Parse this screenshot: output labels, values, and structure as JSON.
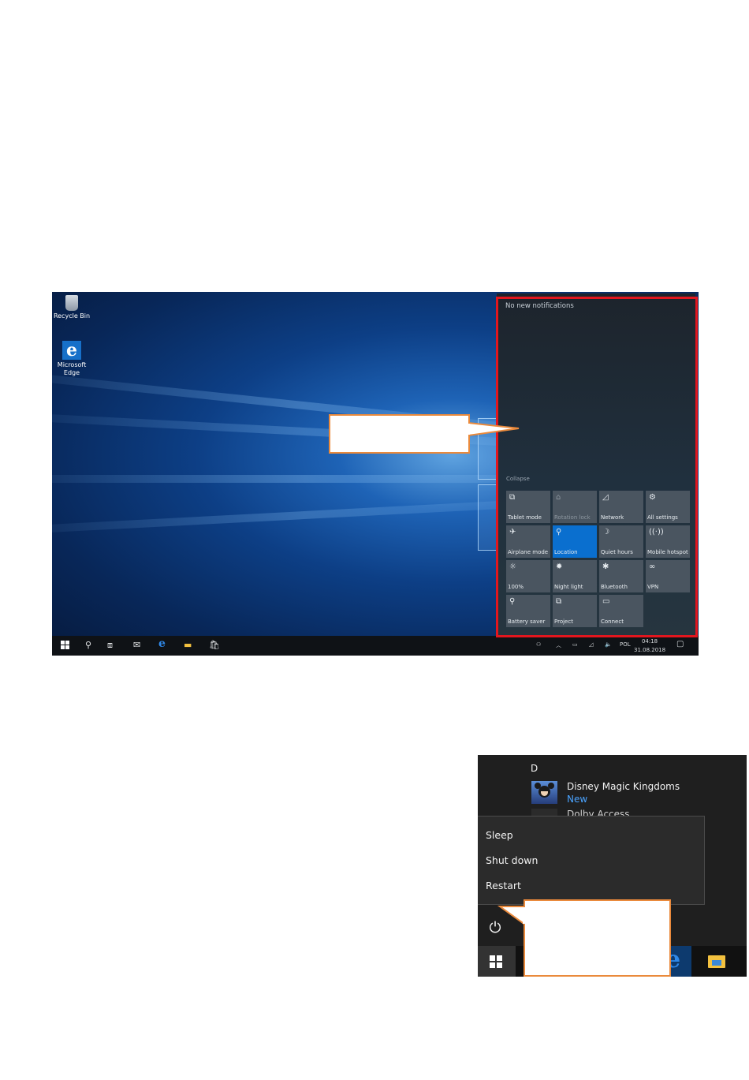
{
  "desktop": {
    "icons": [
      {
        "label": "Recycle Bin",
        "icon": "recycle-bin-icon"
      },
      {
        "label": "Microsoft Edge",
        "icon": "edge-icon"
      }
    ]
  },
  "action_center": {
    "title": "No new notifications",
    "collapse_label": "Collapse",
    "tiles": [
      {
        "label": "Tablet mode",
        "icon": "tablet-mode-icon",
        "glyph": "⧉",
        "state": "off"
      },
      {
        "label": "Rotation lock",
        "icon": "rotation-lock-icon",
        "glyph": "⌂",
        "state": "disabled"
      },
      {
        "label": "Network",
        "icon": "network-icon",
        "glyph": "◿",
        "state": "off"
      },
      {
        "label": "All settings",
        "icon": "gear-icon",
        "glyph": "⚙",
        "state": "off"
      },
      {
        "label": "Airplane mode",
        "icon": "airplane-icon",
        "glyph": "✈",
        "state": "off"
      },
      {
        "label": "Location",
        "icon": "location-icon",
        "glyph": "⚲",
        "state": "on"
      },
      {
        "label": "Quiet hours",
        "icon": "moon-icon",
        "glyph": "☽",
        "state": "off"
      },
      {
        "label": "Mobile hotspot",
        "icon": "hotspot-icon",
        "glyph": "((·))",
        "state": "off"
      },
      {
        "label": "100%",
        "icon": "brightness-icon",
        "glyph": "☼",
        "state": "off"
      },
      {
        "label": "Night light",
        "icon": "night-light-icon",
        "glyph": "✹",
        "state": "off"
      },
      {
        "label": "Bluetooth",
        "icon": "bluetooth-icon",
        "glyph": "✱",
        "state": "off"
      },
      {
        "label": "VPN",
        "icon": "vpn-icon",
        "glyph": "∞",
        "state": "off"
      },
      {
        "label": "Battery saver",
        "icon": "battery-saver-icon",
        "glyph": "⚲",
        "state": "off"
      },
      {
        "label": "Project",
        "icon": "project-icon",
        "glyph": "⧉",
        "state": "off"
      },
      {
        "label": "Connect",
        "icon": "connect-icon",
        "glyph": "▭",
        "state": "off"
      }
    ]
  },
  "taskbar": {
    "language": "POL",
    "time": "04:18",
    "date": "31.08.2018"
  },
  "start_menu": {
    "section_letter": "D",
    "app_name": "Disney Magic Kingdoms",
    "app_badge": "New",
    "next_app_name": "Dolby Access",
    "power_options": [
      "Sleep",
      "Shut down",
      "Restart"
    ]
  },
  "colors": {
    "highlight_border": "#e2161e",
    "callout_border": "#ea8a3c",
    "active_tile": "#0a6fcf",
    "new_badge": "#4aa3ff"
  }
}
